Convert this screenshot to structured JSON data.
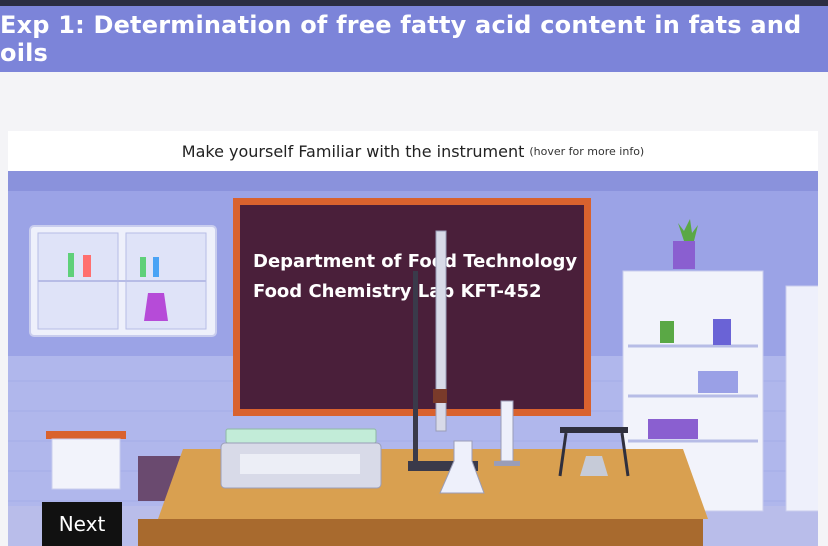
{
  "header": {
    "title": "Exp 1: Determination of free fatty acid content in fats and oils"
  },
  "instrument_panel": {
    "caption": "Make yourself Familiar with the instrument",
    "hint": "(hover for more info)"
  },
  "blackboard": {
    "line1": "Department of Food Technology",
    "line2": "Food Chemistry Lab  KFT-452"
  },
  "navigation": {
    "next_label": "Next"
  },
  "colors": {
    "header_bg": "#7c84d9",
    "wall": "#9ba3e6",
    "board": "#4a1f3a",
    "board_frame": "#d9622e",
    "table_top": "#d9a050",
    "next_button": "#111111"
  }
}
